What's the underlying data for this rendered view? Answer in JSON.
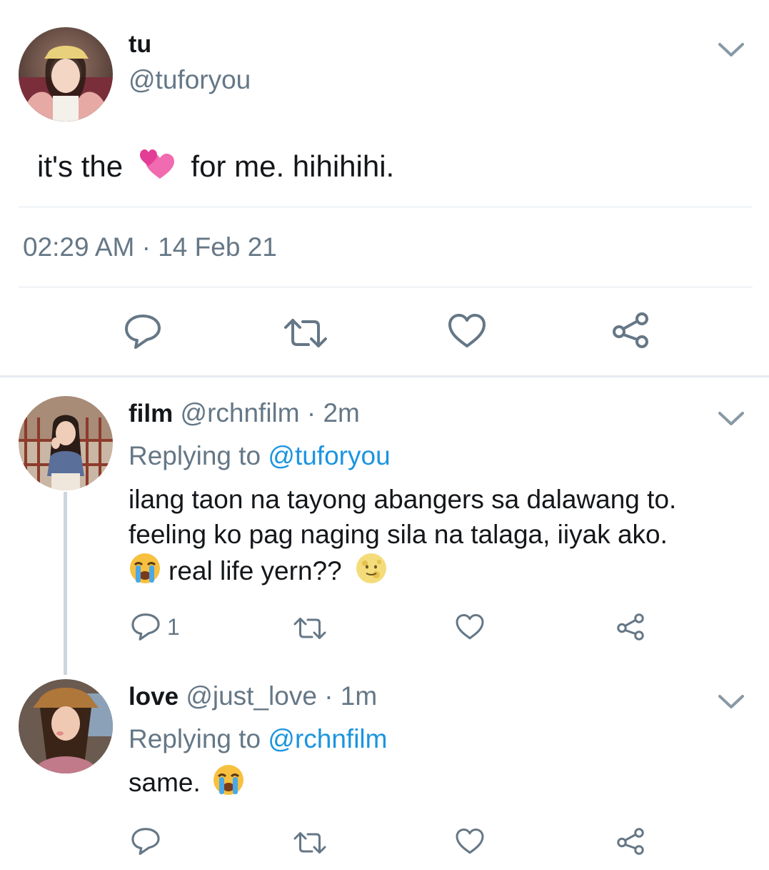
{
  "main_tweet": {
    "display_name": "tu",
    "handle": "@tuforyou",
    "text_before": "it's the",
    "text_after": "for me. hihihihi.",
    "emoji": "two-hearts-emoji",
    "timestamp": "02:29 AM",
    "separator": "·",
    "date": "14 Feb 21"
  },
  "replies": [
    {
      "display_name": "film",
      "handle": "@rchnfilm",
      "time": "· 2m",
      "replying_prefix": "Replying to",
      "replying_to": "@tuforyou",
      "line1": "ilang taon na tayong abangers sa dalawang to.",
      "line2": "feeling ko pag naging sila na talaga, iiyak ako.",
      "line3_text": "real life yern??",
      "reply_count": "1"
    },
    {
      "display_name": "love",
      "handle": "@just_love",
      "time": "· 1m",
      "replying_prefix": "Replying to",
      "replying_to": "@rchnfilm",
      "text": "same."
    }
  ],
  "icons": {
    "reply": "reply-icon",
    "retweet": "retweet-icon",
    "like": "heart-icon",
    "share": "share-icon",
    "more": "chevron-down-icon"
  },
  "colors": {
    "text": "#14171a",
    "muted": "#657786",
    "link": "#1b95e0",
    "divider": "#e1e8ed",
    "thread_line": "#ccd6dd"
  }
}
